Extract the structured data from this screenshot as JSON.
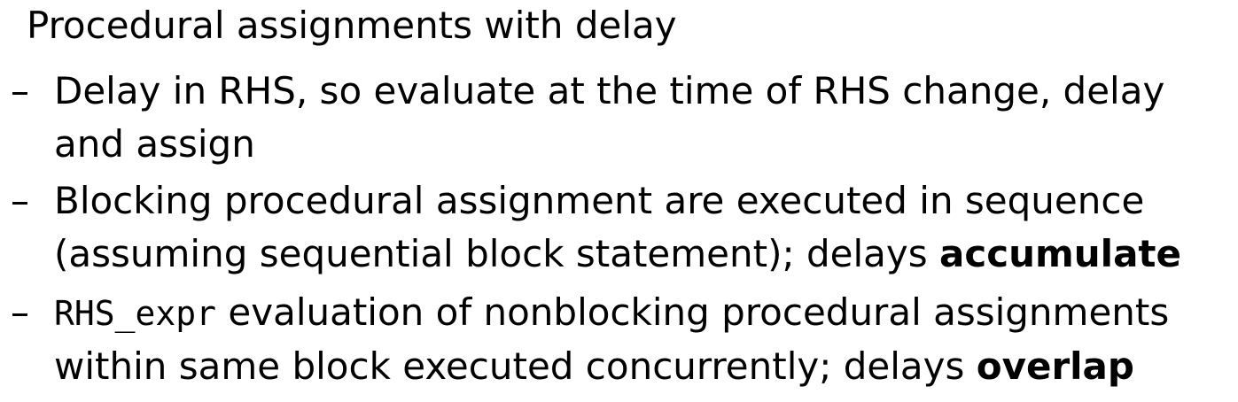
{
  "heading": "Procedural assignments with delay",
  "bullet_marker": "–",
  "bullets": [
    {
      "parts": [
        {
          "text": "Delay in RHS, so evaluate at the time of RHS change, delay and assign"
        }
      ]
    },
    {
      "parts": [
        {
          "text": "Blocking procedural assignment are executed in sequence (assuming sequential block statement); delays "
        },
        {
          "text": "accumulate"
        }
      ]
    },
    {
      "parts": [
        {
          "text": "RHS_expr"
        },
        {
          "text": " evaluation of nonblocking procedural assignments within same block executed concurrently; delays "
        },
        {
          "text": "overlap"
        }
      ]
    }
  ]
}
